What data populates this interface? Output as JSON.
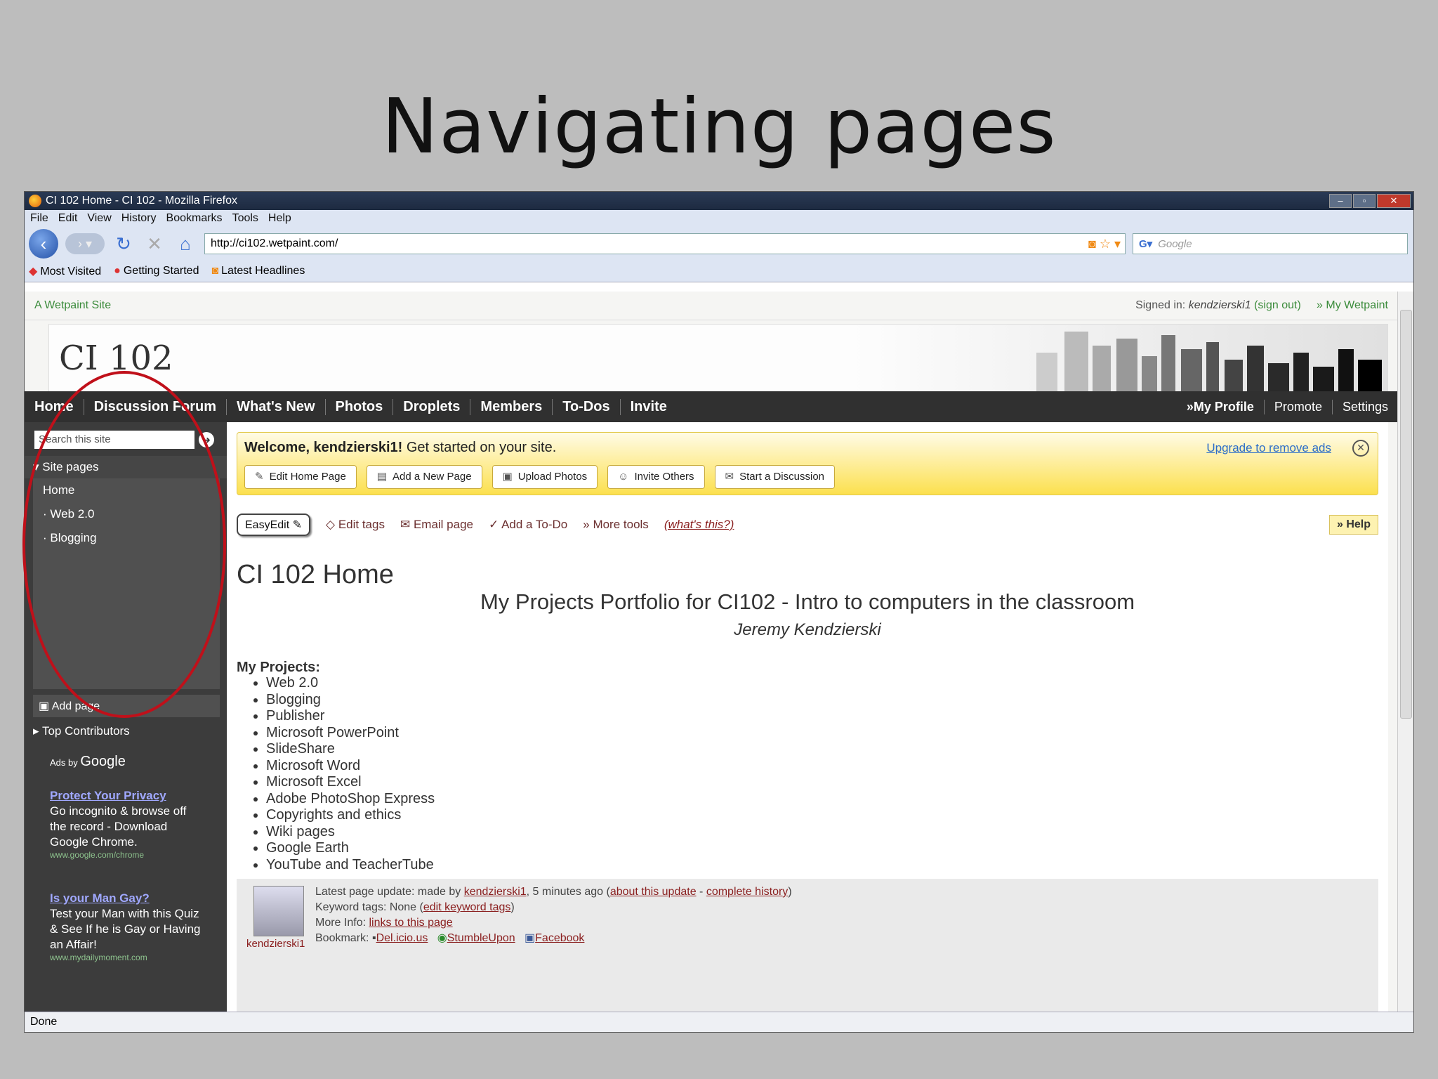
{
  "slide": {
    "title": "Navigating pages"
  },
  "window": {
    "title": "CI 102 Home - CI 102 - Mozilla Firefox",
    "menu": [
      "File",
      "Edit",
      "View",
      "History",
      "Bookmarks",
      "Tools",
      "Help"
    ],
    "url": "http://ci102.wetpaint.com/",
    "search_placeholder": "Google",
    "bookmarks": [
      "Most Visited",
      "Getting Started",
      "Latest Headlines"
    ],
    "status": "Done"
  },
  "site": {
    "tagline": "A Wetpaint Site",
    "signed_in_label": "Signed in:",
    "signed_in_user": "kendzierski1",
    "sign_out": "(sign out)",
    "my_wetpaint": "» My Wetpaint",
    "logo": "CI 102",
    "nav": [
      "Home",
      "Discussion Forum",
      "What's New",
      "Photos",
      "Droplets",
      "Members",
      "To-Dos",
      "Invite"
    ],
    "nav_right": [
      "»My Profile",
      "Promote",
      "Settings"
    ]
  },
  "sidebar": {
    "search_placeholder": "Search this site",
    "site_pages_label": "Site pages",
    "pages": [
      "Home",
      "Web 2.0",
      "Blogging"
    ],
    "add_page": "Add page",
    "top_contributors": "Top Contributors",
    "ads_by": "Ads by",
    "ads_brand": "Google",
    "ads": [
      {
        "title": "Protect Your Privacy",
        "body": "Go incognito & browse off the record - Download Google Chrome.",
        "url": "www.google.com/chrome"
      },
      {
        "title": "Is your Man Gay?",
        "body": "Test your Man with this Quiz & See If he is Gay or Having an Affair!",
        "url": "www.mydailymoment.com"
      }
    ]
  },
  "welcome": {
    "greeting": "Welcome, kendzierski1!",
    "message": "Get started on your site.",
    "upgrade": "Upgrade to remove ads",
    "buttons": [
      "Edit Home Page",
      "Add a New Page",
      "Upload Photos",
      "Invite Others",
      "Start a Discussion"
    ]
  },
  "tools": {
    "easyedit": "EasyEdit",
    "items": [
      "Edit tags",
      "Email page",
      "Add a To-Do",
      "» More tools"
    ],
    "whats_this": "(what's this?)",
    "help": "» Help"
  },
  "page": {
    "title": "CI 102 Home",
    "subtitle": "My Projects Portfolio for CI102 - Intro to computers in the classroom",
    "author": "Jeremy Kendzierski",
    "projects_heading": "My Projects:",
    "projects": [
      "Web 2.0",
      "Blogging",
      "Publisher",
      "Microsoft PowerPoint",
      "SlideShare",
      "Microsoft Word",
      "Microsoft Excel",
      "Adobe PhotoShop Express",
      "Copyrights and ethics",
      "Wiki pages",
      "Google Earth",
      "YouTube and TeacherTube"
    ]
  },
  "footer": {
    "update_prefix": "Latest page update: made by",
    "update_user": "kendzierski1",
    "update_when": ", 5 minutes ago (",
    "about_update": "about this update",
    "complete_history": "complete history",
    "keyword_label": "Keyword tags: None (",
    "edit_keyword": "edit keyword tags",
    "more_info_label": "More Info:",
    "links_to_page": "links to this page",
    "bookmark_label": "Bookmark:",
    "bookmarks": [
      "Del.icio.us",
      "StumbleUpon",
      "Facebook"
    ],
    "username": "kendzierski1"
  }
}
